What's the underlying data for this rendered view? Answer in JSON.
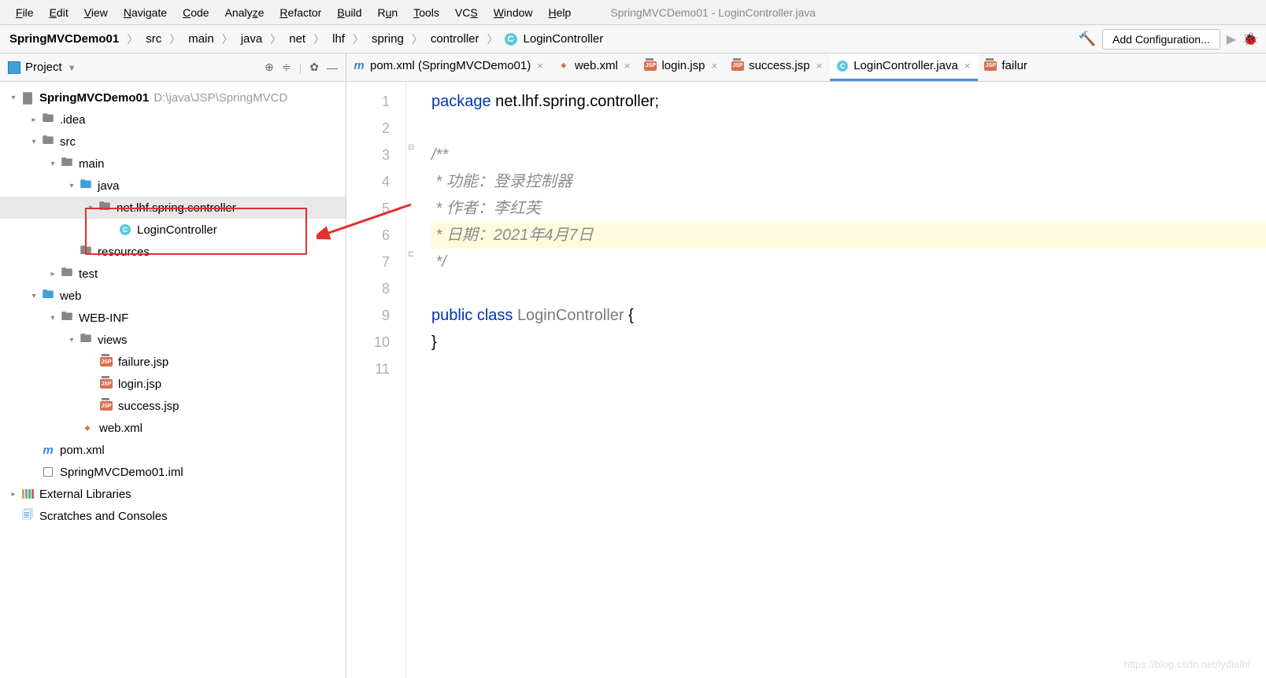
{
  "window_title": "SpringMVCDemo01 - LoginController.java",
  "menu": [
    "File",
    "Edit",
    "View",
    "Navigate",
    "Code",
    "Analyze",
    "Refactor",
    "Build",
    "Run",
    "Tools",
    "VCS",
    "Window",
    "Help"
  ],
  "breadcrumb": [
    "SpringMVCDemo01",
    "src",
    "main",
    "java",
    "net",
    "lhf",
    "spring",
    "controller",
    "LoginController"
  ],
  "add_config": "Add Configuration...",
  "project_title": "Project",
  "tree": {
    "root_name": "SpringMVCDemo01",
    "root_path": "D:\\java\\JSP\\SpringMVCD",
    "idea": ".idea",
    "src": "src",
    "main": "main",
    "java": "java",
    "pkg": "net.lhf.spring.controller",
    "ctrl": "LoginController",
    "resources": "resources",
    "test": "test",
    "web": "web",
    "webinf": "WEB-INF",
    "views": "views",
    "failure": "failure.jsp",
    "login": "login.jsp",
    "success": "success.jsp",
    "webxml": "web.xml",
    "pom": "pom.xml",
    "iml": "SpringMVCDemo01.iml",
    "ext": "External Libraries",
    "scratch": "Scratches and Consoles"
  },
  "tabs": [
    {
      "label": "pom.xml (SpringMVCDemo01)",
      "type": "m"
    },
    {
      "label": "web.xml",
      "type": "xml"
    },
    {
      "label": "login.jsp",
      "type": "jsp"
    },
    {
      "label": "success.jsp",
      "type": "jsp"
    },
    {
      "label": "LoginController.java",
      "type": "c",
      "active": true
    },
    {
      "label": "failur",
      "type": "jsp"
    }
  ],
  "code": {
    "l1_kw": "package",
    "l1_rest": " net.lhf.spring.controller;",
    "l3": "/**",
    "l4": " * 功能：登录控制器",
    "l5": " * 作者：李红芙",
    "l6": " * 日期：2021年4月7日",
    "l7": " */",
    "l9_a": "public ",
    "l9_b": "class ",
    "l9_c": "LoginController ",
    "l9_d": "{",
    "l10": "}"
  },
  "watermark": "https://blog.csdn.net/lydialhf"
}
